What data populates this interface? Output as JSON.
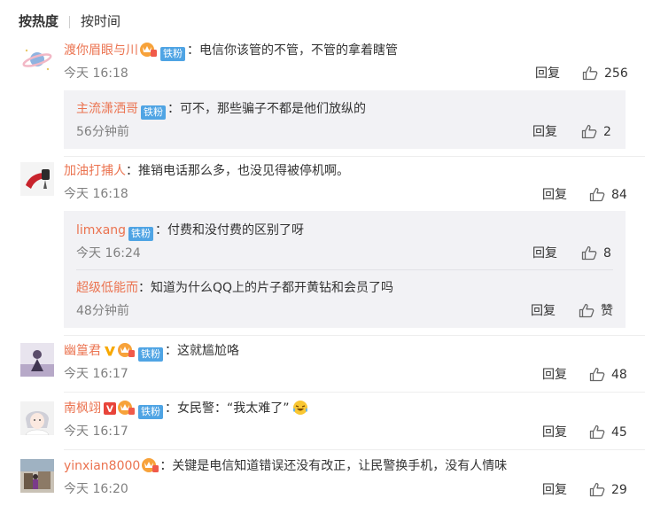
{
  "sort": {
    "hot": "按热度",
    "time": "按时间"
  },
  "labels": {
    "reply": "回复",
    "fan_badge": "铁粉"
  },
  "colors": {
    "username": "#eb7350",
    "badge": "#4fa4e4",
    "sub_bg": "#f2f2f5"
  },
  "comments": [
    {
      "user": "渡你眉眼与川",
      "text": "：电信你该管的不管，不管的拿着瞎管",
      "time": "今天 16:18",
      "likes": "256",
      "replies": [
        {
          "user": "主流潇洒哥",
          "text": "：可不，那些骗子不都是他们放纵的",
          "time": "56分钟前",
          "likes": "2"
        }
      ]
    },
    {
      "user": "加油打捕人",
      "text": "：推销电话那么多，也没见得被停机啊。",
      "time": "今天 16:18",
      "likes": "84",
      "replies": [
        {
          "user": "limxang",
          "text": "：付费和没付费的区别了呀",
          "time": "今天 16:24",
          "likes": "8"
        },
        {
          "user": "超级低能而",
          "text": "：知道为什么QQ上的片子都开黄钻和会员了吗",
          "time": "48分钟前",
          "likes": "赞"
        }
      ]
    },
    {
      "user": "幽篁君",
      "text": "：这就尴尬咯",
      "time": "今天 16:17",
      "likes": "48"
    },
    {
      "user": "南枫翊",
      "text": "：女民警：“我太难了”",
      "time": "今天 16:17",
      "likes": "45"
    },
    {
      "user": "yinxian8000",
      "text": "：关键是电信知道错误还没有改正，让民警换手机，没有人情味",
      "time": "今天 16:20",
      "likes": "29"
    }
  ]
}
